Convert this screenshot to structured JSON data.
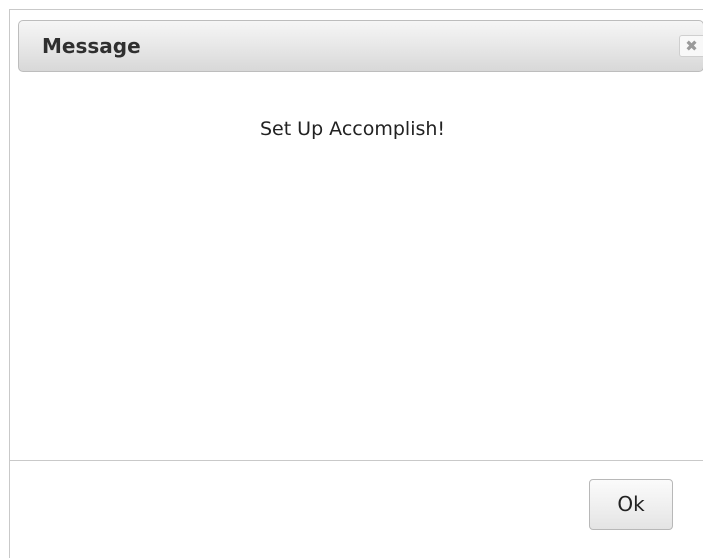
{
  "dialog": {
    "title": "Message",
    "close_icon": "close-icon",
    "close_glyph": "✖",
    "message": "Set Up Accomplish!",
    "ok_label": "Ok"
  },
  "colors": {
    "title_text": "#2f2f2f",
    "close_glyph": "#9a9a9a",
    "border": "#c9c9c9"
  }
}
